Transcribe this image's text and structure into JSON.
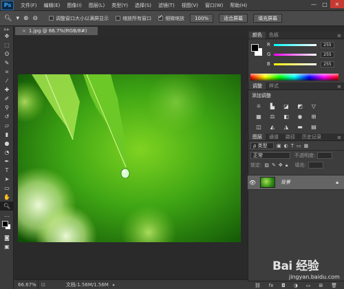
{
  "app": {
    "logo_text": "Ps"
  },
  "menu": [
    "文件(F)",
    "编辑(E)",
    "图像(I)",
    "图层(L)",
    "类型(Y)",
    "选择(S)",
    "滤镜(T)",
    "视图(V)",
    "窗口(W)",
    "帮助(H)"
  ],
  "options_bar": {
    "resize_windows_label": "调整窗口大小以满屏显示",
    "resize_windows_checked": false,
    "zoom_all_label": "缩放所有窗口",
    "zoom_all_checked": false,
    "scrubby_zoom_label": "细微缩放",
    "scrubby_zoom_checked": true,
    "btn_100": "100%",
    "btn_fit": "适合屏幕",
    "btn_fill": "填充屏幕"
  },
  "document": {
    "tab_title": "1.jpg @ 66.7%(RGB/8#)",
    "status_zoom": "66.67%",
    "status_doc": "文档:1.56M/1.56M"
  },
  "color_panel": {
    "tabs": [
      "颜色",
      "色板"
    ],
    "r_label": "R",
    "r_value": "255",
    "g_label": "G",
    "g_value": "255",
    "b_label": "B",
    "b_value": "255"
  },
  "adjustments_panel": {
    "tabs": [
      "调整",
      "样式"
    ],
    "title": "添加调整"
  },
  "layers_panel": {
    "tabs": [
      "图层",
      "通道",
      "路径",
      "历史记录"
    ],
    "filter_kind": "ρ 类型",
    "blend_mode": "正常",
    "opacity_label": "不透明度:",
    "lock_label": "锁定:",
    "fill_label": "填充:",
    "layer_name": "背景"
  },
  "watermark": {
    "brand": "Bai 经验",
    "url": "jingyan.baidu.com"
  },
  "colors": {
    "accent": "#31a8ff",
    "canvas_bg": "#2a2a2a",
    "panel_bg": "#3d3d3d",
    "layer_selected": "#646464"
  }
}
